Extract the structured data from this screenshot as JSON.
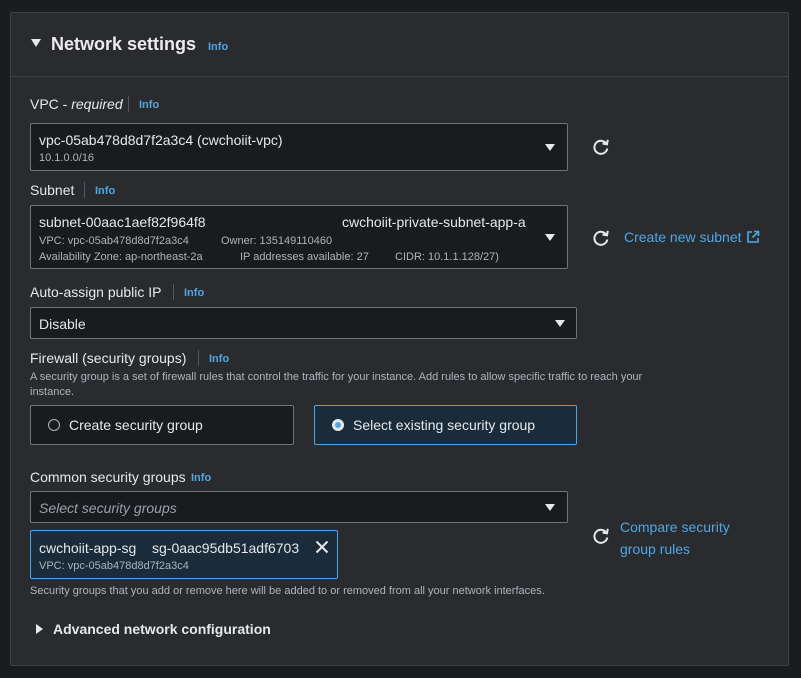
{
  "section": {
    "title": "Network settings",
    "info": "Info"
  },
  "vpc": {
    "label": "VPC - ",
    "required": "required",
    "info": "Info",
    "value": "vpc-05ab478d8d7f2a3c4 (cwchoiit-vpc)",
    "cidr": "10.1.0.0/16"
  },
  "subnet": {
    "label": "Subnet",
    "info": "Info",
    "id": "subnet-00aac1aef82f964f8",
    "name": "cwchoiit-private-subnet-app-a",
    "vpc": "VPC: vpc-05ab478d8d7f2a3c4",
    "owner": "Owner: 135149110460",
    "az": "Availability Zone: ap-northeast-2a",
    "ips": "IP addresses available: 27",
    "cidr": "CIDR: 10.1.1.128/27)",
    "create_link": "Create new subnet"
  },
  "auto_ip": {
    "label": "Auto-assign public IP",
    "info": "Info",
    "value": "Disable"
  },
  "firewall": {
    "label": "Firewall (security groups)",
    "info": "Info",
    "description_line1": "A security group is a set of firewall rules that control the traffic for your instance. Add rules to allow specific traffic to reach your",
    "description_line2": "instance.",
    "option_create": "Create security group",
    "option_select": "Select existing security group",
    "selected": "Select existing security group"
  },
  "common_sg": {
    "label": "Common security groups",
    "info": "Info",
    "placeholder": "Select security groups",
    "token_name": "cwchoiit-app-sg",
    "token_id": "sg-0aac95db51adf6703",
    "token_vpc": "VPC: vpc-05ab478d8d7f2a3c4",
    "compare_line1": "Compare security",
    "compare_line2": "group rules",
    "footnote": "Security groups that you add or remove here will be added to or removed from all your network interfaces."
  },
  "advanced": {
    "label": "Advanced network configuration"
  },
  "colors": {
    "accent": "#4ea7e3",
    "panel": "#2a2b2f",
    "field": "#1a1b1e"
  },
  "icons": [
    "caret-down-icon",
    "refresh-icon",
    "external-link-icon",
    "close-icon",
    "caret-right-icon"
  ]
}
